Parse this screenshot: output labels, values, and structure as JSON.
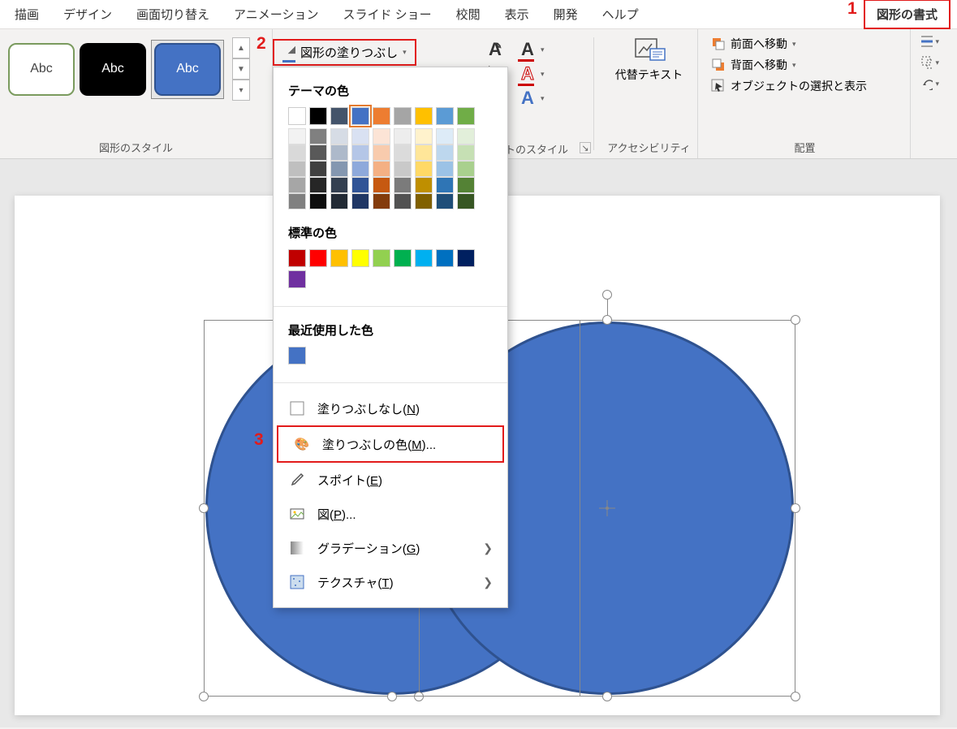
{
  "tabs": {
    "draw": "描画",
    "design": "デザイン",
    "transitions": "画面切り替え",
    "animations": "アニメーション",
    "slideshow": "スライド ショー",
    "review": "校閲",
    "view": "表示",
    "developer": "開発",
    "help": "ヘルプ",
    "shape_format": "図形の書式"
  },
  "annotations": {
    "one": "1",
    "two": "2",
    "three": "3"
  },
  "ribbon": {
    "style_label_text": "Abc",
    "shape_styles_group": "図形のスタイル",
    "shape_fill": "図形の塗りつぶし",
    "wordart_styles_group": "トのスタイル",
    "accessibility_group": "アクセシビリティ",
    "alt_text": "代替テキスト",
    "bring_forward": "前面へ移動",
    "send_backward": "背面へ移動",
    "selection_pane": "オブジェクトの選択と表示",
    "arrange_group": "配置"
  },
  "dropdown": {
    "theme_colors": "テーマの色",
    "standard_colors": "標準の色",
    "recent_colors": "最近使用した色",
    "no_fill": "塗りつぶしなし(",
    "no_fill_key": "N",
    "no_fill_suffix": ")",
    "more_colors": "塗りつぶしの色(",
    "more_colors_key": "M",
    "more_colors_suffix": ")...",
    "eyedropper": "スポイト(",
    "eyedropper_key": "E",
    "eyedropper_suffix": ")",
    "picture": "図(",
    "picture_key": "P",
    "picture_suffix": ")...",
    "gradient": "グラデーション(",
    "gradient_key": "G",
    "gradient_suffix": ")",
    "texture": "テクスチャ(",
    "texture_key": "T",
    "texture_suffix": ")"
  },
  "colors": {
    "theme_row": [
      "#ffffff",
      "#000000",
      "#44546a",
      "#4472c4",
      "#ed7d31",
      "#a5a5a5",
      "#ffc000",
      "#5b9bd5",
      "#70ad47"
    ],
    "theme_selected": "#4472c4",
    "tints": {
      "white": [
        "#f2f2f2",
        "#d9d9d9",
        "#bfbfbf",
        "#a6a6a6",
        "#808080"
      ],
      "black": [
        "#808080",
        "#595959",
        "#404040",
        "#262626",
        "#0d0d0d"
      ],
      "darkblue": [
        "#d6dce5",
        "#adb9ca",
        "#8497b0",
        "#333f50",
        "#222a35"
      ],
      "blue": [
        "#d9e1f2",
        "#b4c6e7",
        "#8ea9db",
        "#305496",
        "#203764"
      ],
      "orange": [
        "#fce4d6",
        "#f8cbad",
        "#f4b084",
        "#c65911",
        "#833c0c"
      ],
      "gray": [
        "#ededed",
        "#dbdbdb",
        "#c9c9c9",
        "#7b7b7b",
        "#525252"
      ],
      "gold": [
        "#fff2cc",
        "#ffe699",
        "#ffd966",
        "#bf8f00",
        "#806000"
      ],
      "lightblue": [
        "#ddebf7",
        "#bdd7ee",
        "#9bc2e6",
        "#2f75b5",
        "#1f4e78"
      ],
      "green": [
        "#e2efda",
        "#c6e0b4",
        "#a9d08e",
        "#548235",
        "#375623"
      ]
    },
    "standard": [
      "#c00000",
      "#ff0000",
      "#ffc000",
      "#ffff00",
      "#92d050",
      "#00b050",
      "#00b0f0",
      "#0070c0",
      "#002060",
      "#7030a0"
    ],
    "recent": [
      "#4472c4"
    ]
  }
}
